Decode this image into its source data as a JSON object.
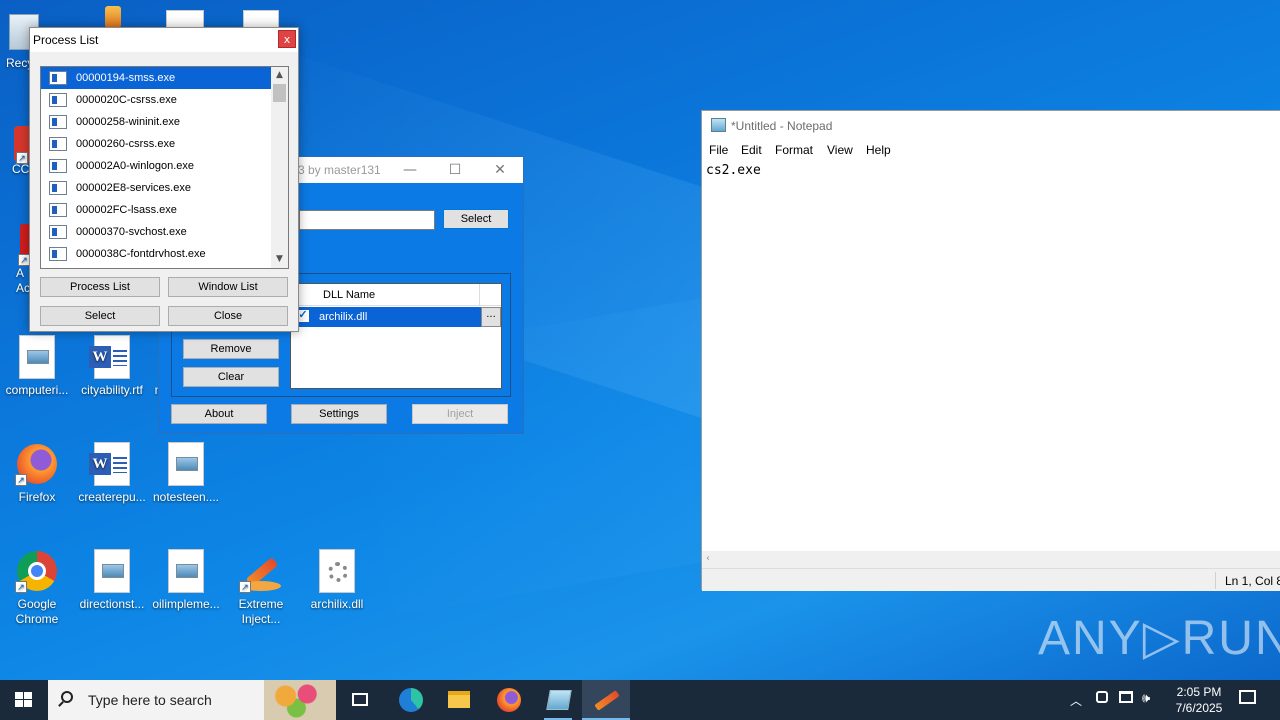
{
  "desktop": {
    "icons": [
      {
        "label": "Recy"
      },
      {
        "label": "CC"
      },
      {
        "label": "A\nAc"
      },
      {
        "label": "computeri..."
      },
      {
        "label": "cityability.rtf"
      },
      {
        "label": "n"
      },
      {
        "label": "Firefox"
      },
      {
        "label": "createrepu..."
      },
      {
        "label": "notesteen...."
      },
      {
        "label": "Google\nChrome"
      },
      {
        "label": "directionst..."
      },
      {
        "label": "oilimpleme..."
      },
      {
        "label": "Extreme\nInject..."
      },
      {
        "label": "archilix.dll"
      }
    ]
  },
  "process_list": {
    "title": "Process List",
    "close_label": "x",
    "items": [
      {
        "label": "00000194-smss.exe",
        "selected": true
      },
      {
        "label": "0000020C-csrss.exe"
      },
      {
        "label": "00000258-wininit.exe"
      },
      {
        "label": "00000260-csrss.exe"
      },
      {
        "label": "000002A0-winlogon.exe"
      },
      {
        "label": "000002E8-services.exe"
      },
      {
        "label": "000002FC-lsass.exe"
      },
      {
        "label": "00000370-svchost.exe"
      },
      {
        "label": "0000038C-fontdrvhost.exe"
      }
    ],
    "buttons": {
      "process_list": "Process List",
      "window_list": "Window List",
      "select": "Select",
      "close": "Close"
    }
  },
  "injector": {
    "title": "3 by master131",
    "select_label": "Select",
    "dll_header": "DLL Name",
    "dll_rows": [
      {
        "name": "archilix.dll",
        "checked": true
      }
    ],
    "more_label": "...",
    "remove_label": "Remove",
    "clear_label": "Clear",
    "about_label": "About",
    "settings_label": "Settings",
    "inject_label": "Inject"
  },
  "notepad": {
    "title": "*Untitled - Notepad",
    "menu": [
      "File",
      "Edit",
      "Format",
      "View",
      "Help"
    ],
    "content": "cs2.exe",
    "status": "Ln 1, Col 8"
  },
  "watermark": "ANY▷RUN",
  "taskbar": {
    "search_placeholder": "Type here to search",
    "time": "2:05 PM",
    "date": "7/6/2025"
  }
}
